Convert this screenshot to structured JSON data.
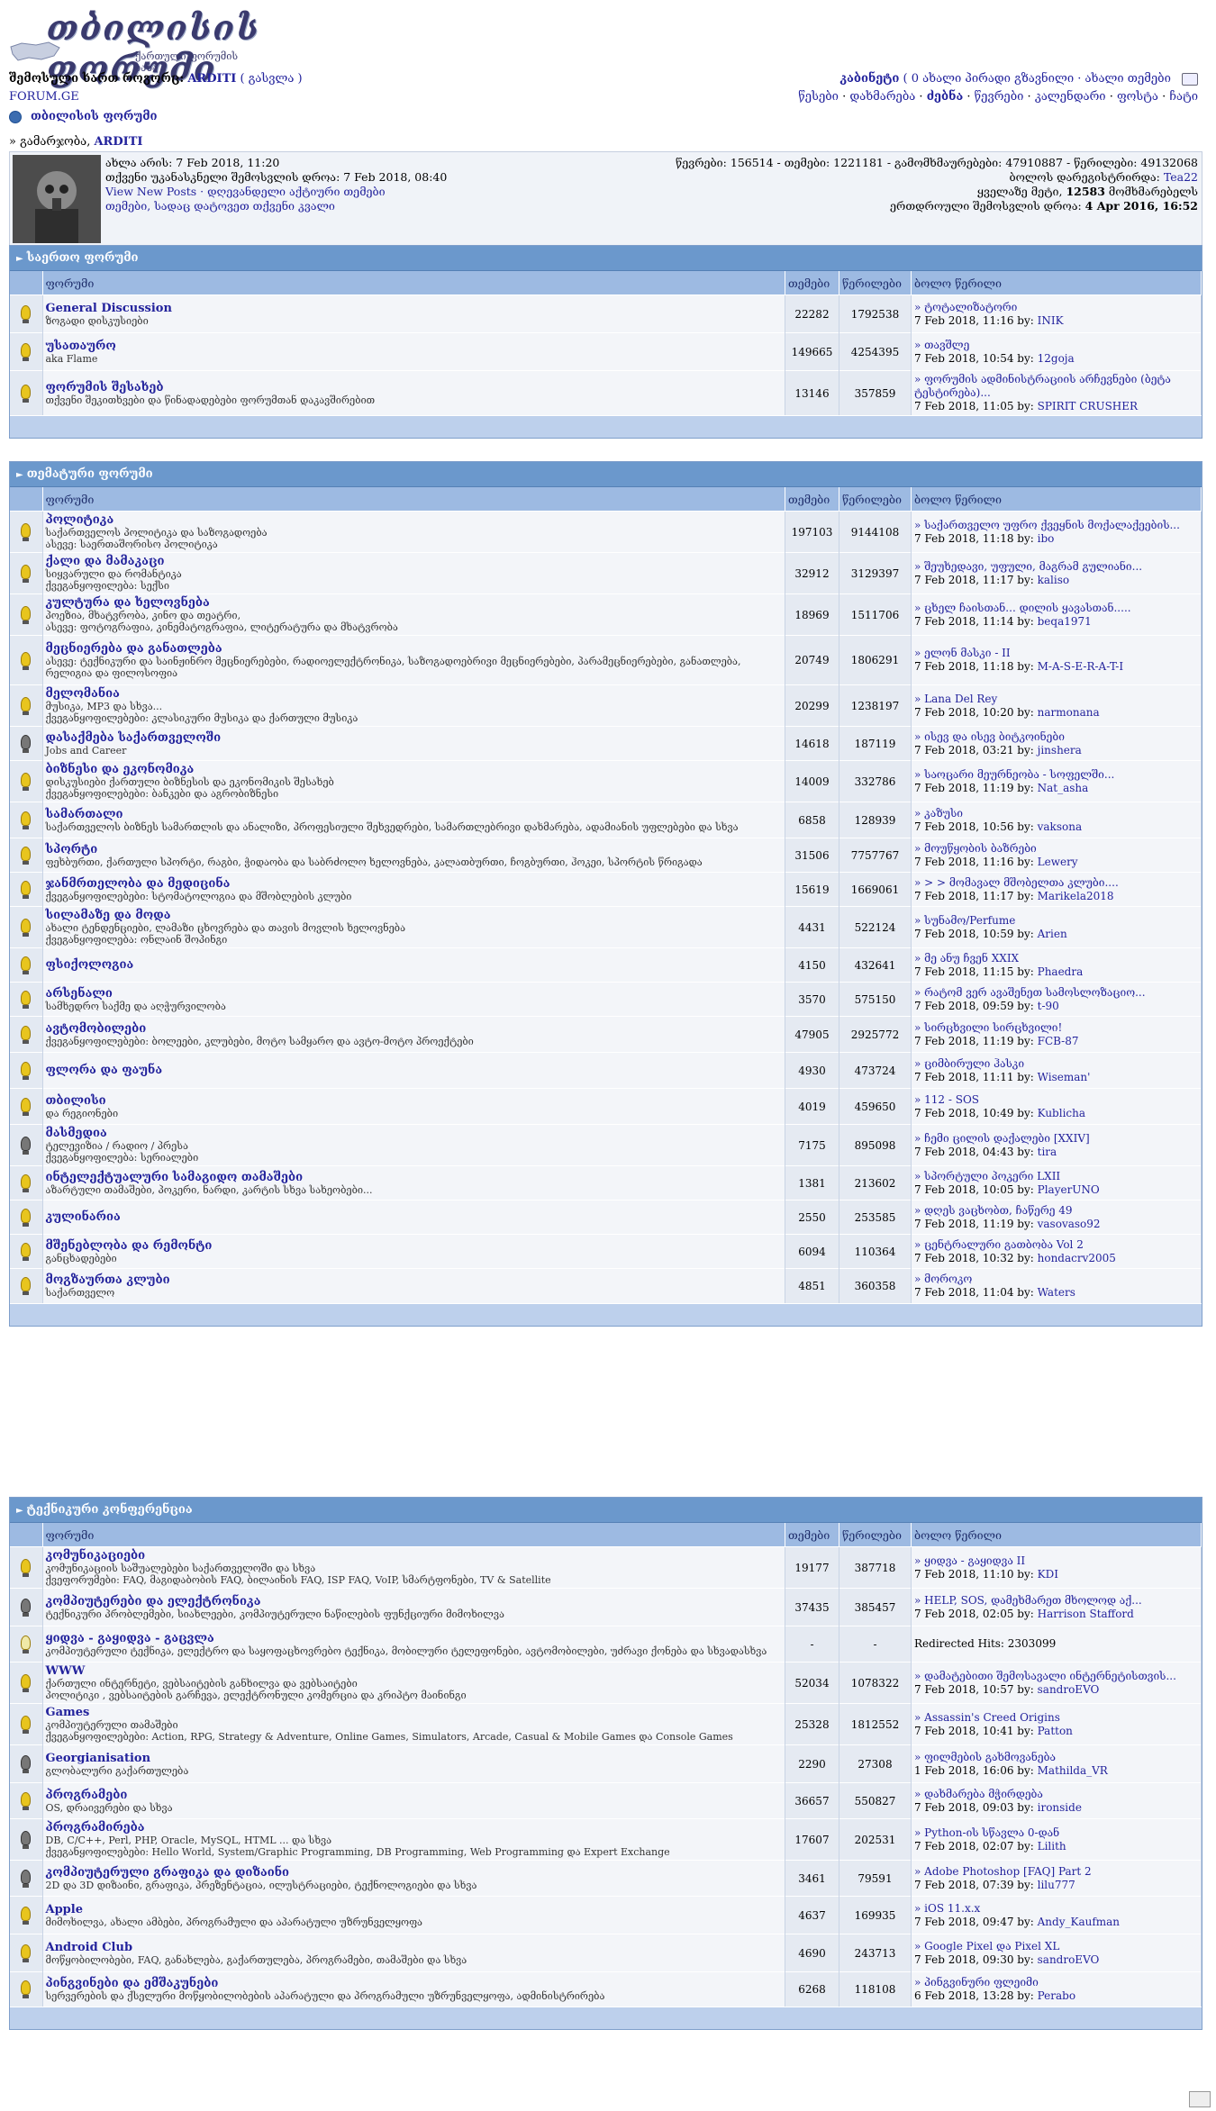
{
  "logo": {
    "title": "თბილისის ფორუმი",
    "subtitle": "ქართული ფორუმის ბაზა"
  },
  "top_left": {
    "logged_as_label": "შემოსული ხართ როგორც:",
    "username": "ARDITI",
    "logout": "( გასვლა )",
    "site": "FORUM.GE"
  },
  "top_right": {
    "line1_cabinet": "კაბინეტი",
    "line1_rest": "( 0 ახალი პირადი გზავნილი · ახალი თემები",
    "line2": [
      "წესები",
      "დახმარება",
      "ძებნა",
      "წევრები",
      "კალენდარი",
      "ფოსტა",
      "ჩატი"
    ]
  },
  "forum_title": "თბილისის ფორუმი",
  "welcome_prefix": "» გამარჯობა,",
  "welcome_user": "ARDITI",
  "info": {
    "left": [
      "ახლა არის: 7 Feb 2018, 11:20",
      "თქვენი უკანასკნელი შემოსვლის დროა: 7 Feb 2018, 08:40",
      "View New Posts · დღევანდელი აქტიური თემები",
      "თემები, სადაც დატოვეთ თქვენი კვალი"
    ],
    "right": [
      "წევრები: 156514 - თემები: 1221181 - გამომხმაურებები: 47910887 - წერილები: 49132068",
      "ბოლოს დარეგისტრირდა:",
      "Tea22",
      "ყველაზე მეტი,",
      "12583",
      "მომხმარებელს",
      "ერთდროული შემოსვლის დროა:",
      "4 Apr 2016, 16:52"
    ]
  },
  "columns": [
    "ფორუმი",
    "თემები",
    "წერილები",
    "ბოლო წერილი"
  ],
  "sections": [
    {
      "title": "საერთო ფორუმი",
      "forums": [
        {
          "name": "General Discussion",
          "desc": "ზოგადი დისკუსიები",
          "topics": "22282",
          "posts": "1792538",
          "last_title": "» ტოტალიზატორი",
          "last_date": "7 Feb 2018, 11:16 by:",
          "last_by": "INIK",
          "icon": "on"
        },
        {
          "name": "უსათაურო",
          "desc": "aka Flame",
          "topics": "149665",
          "posts": "4254395",
          "last_title": "» თავშლე",
          "last_date": "7 Feb 2018, 10:54 by:",
          "last_by": "12goja",
          "icon": "on"
        },
        {
          "name": "ფორუმის შესახებ",
          "desc": "თქვენი შეკითხვები და წინადადებები ფორუმთან დაკავშირებით",
          "topics": "13146",
          "posts": "357859",
          "last_title": "» ფორუმის ადმინისტრაციის არჩევნები (ბეტა ტესტირება)...",
          "last_date": "7 Feb 2018, 11:05 by:",
          "last_by": "SPIRIT CRUSHER",
          "icon": "on"
        }
      ]
    },
    {
      "title": "თემატური ფორუმი",
      "forums": [
        {
          "name": "პოლიტიკა",
          "desc": "საქართველოს პოლიტიკა და საზოგადოება",
          "desc2": "ასევე: საერთაშორისო პოლიტიკა",
          "topics": "197103",
          "posts": "9144108",
          "last_title": "» საქართველო უფრო ქვეყნის მოქალაქეების...",
          "last_date": "7 Feb 2018, 11:18 by:",
          "last_by": "ibo",
          "icon": "on"
        },
        {
          "name": "ქალი და მამაკაცი",
          "desc": "სიყვარული და რომანტიკა",
          "desc2": "ქვეგანყოფილება: სექსი",
          "topics": "32912",
          "posts": "3129397",
          "last_title": "» შეუხედავი, უფული, მაგრამ გულიანი...",
          "last_date": "7 Feb 2018, 11:17 by:",
          "last_by": "kaliso",
          "icon": "on"
        },
        {
          "name": "კულტურა და ხელოვნება",
          "desc": "პოეზია, მხატვრობა, კინო და თეატრი,",
          "desc2": "ასევე: ფოტოგრაფია, კინემატოგრაფია, ლიტერატურა და მხატვრობა",
          "topics": "18969",
          "posts": "1511706",
          "last_title": "» ცხელ ჩაისთან... დილის ყავასთან.....",
          "last_date": "7 Feb 2018, 11:14 by:",
          "last_by": "beqa1971",
          "icon": "on"
        },
        {
          "name": "მეცნიერება და განათლება",
          "desc": "ასევე: ტექნიკური და საინჟინრო მეცნიერებები, რადიოელექტრონიკა, საზოგადოებრივი მეცნიერებები, პარამეცნიერებები, განათლება, რელიგია და ფილოსოფია",
          "topics": "20749",
          "posts": "1806291",
          "last_title": "» ელონ მასკი - II",
          "last_date": "7 Feb 2018, 11:18 by:",
          "last_by": "M-A-S-E-R-A-T-I",
          "icon": "on"
        },
        {
          "name": "მელომანია",
          "desc": "მუსიკა, MP3 და სხვა...",
          "desc2": "ქვეგანყოფილებები: კლასიკური მუსიკა და ქართული მუსიკა",
          "topics": "20299",
          "posts": "1238197",
          "last_title": "» Lana Del Rey",
          "last_date": "7 Feb 2018, 10:20 by:",
          "last_by": "narmonana",
          "icon": "on"
        },
        {
          "name": "დასაქმება საქართველოში",
          "desc": "Jobs and Career",
          "topics": "14618",
          "posts": "187119",
          "last_title": "» ისევ და ისევ ბიტკოინები",
          "last_date": "7 Feb 2018, 03:21 by:",
          "last_by": "jinshera",
          "icon": "dark"
        },
        {
          "name": "ბიზნესი და ეკონომიკა",
          "desc": "დისკუსიები ქართული ბიზნესის და ეკონომიკის შესახებ",
          "desc2": "ქვეგანყოფილებები: ბანკები და აგრობიზნესი",
          "topics": "14009",
          "posts": "332786",
          "last_title": "» საოცარი მეურნეობა - სოფელში...",
          "last_date": "7 Feb 2018, 11:19 by:",
          "last_by": "Nat_asha",
          "icon": "on"
        },
        {
          "name": "სამართალი",
          "desc": "საქართველოს ბიზნეს სამართლის და ანალიზი, პროფესიული შეხვედრები, სამართლებრივი დახმარება, ადამიანის უფლებები და სხვა",
          "topics": "6858",
          "posts": "128939",
          "last_title": "» კაზუსი",
          "last_date": "7 Feb 2018, 10:56 by:",
          "last_by": "vaksona",
          "icon": "on"
        },
        {
          "name": "სპორტი",
          "desc": "ფეხბურთი, ქართული სპორტი, რაგბი, ჭიდაობა და საბრძოლო ხელოვნება, კალათბურთი, ჩოგბურთი, ჰოკეი, სპორტის წრიგადა",
          "topics": "31506",
          "posts": "7757767",
          "last_title": "» მოუწყობის ბაზრები",
          "last_date": "7 Feb 2018, 11:16 by:",
          "last_by": "Lewery",
          "icon": "on"
        },
        {
          "name": "ჯანმრთელობა და მედიცინა",
          "desc": "ქვეგანყოფილებები: სტომატოლოგია და მშობლების კლუბი",
          "topics": "15619",
          "posts": "1669061",
          "last_title": "» > > მომავალ მშობელთა კლუბი....",
          "last_date": "7 Feb 2018, 11:17 by:",
          "last_by": "Marikela2018",
          "icon": "on"
        },
        {
          "name": "სილამაზე და მოდა",
          "desc": "ახალი ტენდენციები, ლამაზი ცხოვრება და თავის მოვლის ხელოვნება",
          "desc2": "ქვეგანყოფილება: ონლაინ შოპინგი",
          "topics": "4431",
          "posts": "522124",
          "last_title": "» სუნამო/Perfume",
          "last_date": "7 Feb 2018, 10:59 by:",
          "last_by": "Arien",
          "icon": "on"
        },
        {
          "name": "ფსიქოლოგია",
          "desc": "",
          "topics": "4150",
          "posts": "432641",
          "last_title": "» მე ანუ ჩვენ XXIX",
          "last_date": "7 Feb 2018, 11:15 by:",
          "last_by": "Phaedra",
          "icon": "on"
        },
        {
          "name": "არსენალი",
          "desc": "სამხედრო საქმე და აღჭურვილობა",
          "topics": "3570",
          "posts": "575150",
          "last_title": "» რატომ ვერ ავაშენეთ სამოსლოზაციო...",
          "last_date": "7 Feb 2018, 09:59 by:",
          "last_by": "t-90",
          "icon": "on"
        },
        {
          "name": "ავტომობილები",
          "desc": "ქვეგანყოფილებები: ბოლეები, კლუბები, მოტო სამყარო და ავტო-მოტო პროექტები",
          "topics": "47905",
          "posts": "2925772",
          "last_title": "» სირცხვილი სირცხვილი!",
          "last_date": "7 Feb 2018, 11:19 by:",
          "last_by": "FCB-87",
          "icon": "on"
        },
        {
          "name": "ფლორა და ფაუნა",
          "desc": "",
          "topics": "4930",
          "posts": "473724",
          "last_title": "» ციმბირული ჰასკი",
          "last_date": "7 Feb 2018, 11:11 by:",
          "last_by": "Wiseman'",
          "icon": "on"
        },
        {
          "name": "თბილისი",
          "desc": "და რეგიონები",
          "topics": "4019",
          "posts": "459650",
          "last_title": "» 112 - SOS",
          "last_date": "7 Feb 2018, 10:49 by:",
          "last_by": "Kublicha",
          "icon": "on"
        },
        {
          "name": "მასმედია",
          "desc": "ტელევიზია / რადიო / პრესა",
          "desc2": "ქვეგანყოფილება: სერიალები",
          "topics": "7175",
          "posts": "895098",
          "last_title": "» ჩემი ცილის დაქალები [XXIV]",
          "last_date": "7 Feb 2018, 04:43 by:",
          "last_by": "tira",
          "icon": "dark"
        },
        {
          "name": "ინტელექტუალური სამაგიდო თამაშები",
          "desc": "აზარტული თამაშები, პოკერი, ნარდი, კარტის სხვა სახეობები...",
          "topics": "1381",
          "posts": "213602",
          "last_title": "» სპორტული პოკერი LXII",
          "last_date": "7 Feb 2018, 10:05 by:",
          "last_by": "PlayerUNO",
          "icon": "on"
        },
        {
          "name": "კულინარია",
          "desc": "",
          "topics": "2550",
          "posts": "253585",
          "last_title": "» დღეს ვაცხობთ, ჩაწერე 49",
          "last_date": "7 Feb 2018, 11:19 by:",
          "last_by": "vasovaso92",
          "icon": "on"
        },
        {
          "name": "მშენებლობა და რემონტი",
          "desc": "განცხადებები",
          "topics": "6094",
          "posts": "110364",
          "last_title": "» ცენტრალური გათბობა Vol 2",
          "last_date": "7 Feb 2018, 10:32 by:",
          "last_by": "hondacrv2005",
          "icon": "on"
        },
        {
          "name": "მოგზაურთა კლუბი",
          "desc": "საქართველო",
          "topics": "4851",
          "posts": "360358",
          "last_title": "» მოროკო",
          "last_date": "7 Feb 2018, 11:04 by:",
          "last_by": "Waters",
          "icon": "on"
        }
      ]
    },
    {
      "title": "ტექნიკური კონფერენცია",
      "forums": [
        {
          "name": "კომუნიკაციები",
          "desc": "კომუნიკაციის საშუალებები საქართველოში და სხვა",
          "desc2": "ქვეფორუმები: FAQ, მაგიდაბობის FAQ, ბილაინის FAQ, ISP FAQ, VoIP, სმარტფონები, TV & Satellite",
          "topics": "19177",
          "posts": "387718",
          "last_title": "» ყიდვა - გაყიდვა II",
          "last_date": "7 Feb 2018, 11:10 by:",
          "last_by": "KDI",
          "icon": "on"
        },
        {
          "name": "კომპიუტერები და ელექტრონიკა",
          "desc": "ტექნიკური პრობლემები, სიახლეები, კომპიუტერული ნაწილების ფუნქციური მიმოხილვა",
          "topics": "37435",
          "posts": "385457",
          "last_title": "» HELP, SOS, დამეხმარეთ მხოლოდ აქ...",
          "last_date": "7 Feb 2018, 02:05 by:",
          "last_by": "Harrison Stafford",
          "icon": "dark"
        },
        {
          "name": "ყიდვა - გაყიდვა - გაცვლა",
          "desc": "კომპიუტერული ტექნიკა, ელექტრო და საყოფაცხოვრებო ტექნიკა, მობილური ტელეფონები, ავტომობილები, უძრავი ქონება და სხვადასხვა",
          "topics": "-",
          "posts": "-",
          "last_title": "Redirected Hits: 2303099",
          "last_date": "",
          "last_by": "",
          "icon": "off",
          "redirect": true
        },
        {
          "name": "WWW",
          "desc": "ქართული ინტერნეტი, ვებსაიტების განხილვა და ვებსაიტები",
          "desc2": "პოლიტიკი , ვებსაიტების გარჩევა, ელექტრონული კომერცია და კრიპტო მაინინგი",
          "topics": "52034",
          "posts": "1078322",
          "last_title": "» დამატებითი შემოსავალი ინტერნეტისთვის...",
          "last_date": "7 Feb 2018, 10:57 by:",
          "last_by": "sandroEVO",
          "icon": "on"
        },
        {
          "name": "Games",
          "desc": "კომპიუტერული თამაშები",
          "desc2": "ქვეგანყოფილებები: Action, RPG, Strategy & Adventure, Online Games, Simulators, Arcade, Casual & Mobile Games და Console Games",
          "topics": "25328",
          "posts": "1812552",
          "last_title": "» Assassin's Creed Origins",
          "last_date": "7 Feb 2018, 10:41 by:",
          "last_by": "Patton",
          "icon": "on"
        },
        {
          "name": "Georgianisation",
          "desc": "გლობალური გაქართულება",
          "topics": "2290",
          "posts": "27308",
          "last_title": "» ფილმების გახმოვანება",
          "last_date": "1 Feb 2018, 16:06 by:",
          "last_by": "Mathilda_VR",
          "icon": "dark"
        },
        {
          "name": "პროგრამები",
          "desc": "OS, დრაივერები და სხვა",
          "topics": "36657",
          "posts": "550827",
          "last_title": "» დახმარება მჭირდება",
          "last_date": "7 Feb 2018, 09:03 by:",
          "last_by": "ironside",
          "icon": "on"
        },
        {
          "name": "პროგრამირება",
          "desc": "DB, C/C++, Perl, PHP, Oracle, MySQL, HTML ... და სხვა",
          "desc2": "ქვეგანყოფილებები: Hello World, System/Graphic Programming, DB Programming, Web Programming და Expert Exchange",
          "topics": "17607",
          "posts": "202531",
          "last_title": "» Python-ის სწავლა 0-დან",
          "last_date": "7 Feb 2018, 02:07 by:",
          "last_by": "Lilith",
          "icon": "dark"
        },
        {
          "name": "კომპიუტერული გრაფიკა და დიზაინი",
          "desc": "2D და 3D დიზაინი, გრაფიკა, პრეზენტაცია, ილუსტრაციები, ტექნოლოგიები და სხვა",
          "topics": "3461",
          "posts": "79591",
          "last_title": "» Adobe Photoshop [FAQ] Part 2",
          "last_date": "7 Feb 2018, 07:39 by:",
          "last_by": "lilu777",
          "icon": "dark"
        },
        {
          "name": "Apple",
          "desc": "მიმოხილვა, ახალი ამბები, პროგრამული და აპარატული უზრუნველყოფა",
          "topics": "4637",
          "posts": "169935",
          "last_title": "» iOS 11.x.x",
          "last_date": "7 Feb 2018, 09:47 by:",
          "last_by": "Andy_Kaufman",
          "icon": "on"
        },
        {
          "name": "Android Club",
          "desc": "მოწყობილობები, FAQ, განახლება, გაქართულება, პროგრამები, თამაშები და სხვა",
          "topics": "4690",
          "posts": "243713",
          "last_title": "» Google Pixel და Pixel XL",
          "last_date": "7 Feb 2018, 09:30 by:",
          "last_by": "sandroEVO",
          "icon": "on"
        },
        {
          "name": "პინგვინები და ემშაკუნები",
          "desc": "სერვერების და ქსელური მოწყობილობების აპარატული და პროგრამული უზრუნველყოფა, ადმინისტრირება",
          "topics": "6268",
          "posts": "118108",
          "last_title": "» პინგვინური ფლეიმი",
          "last_date": "6 Feb 2018, 13:28 by:",
          "last_by": "Perabo",
          "icon": "on"
        }
      ]
    }
  ]
}
